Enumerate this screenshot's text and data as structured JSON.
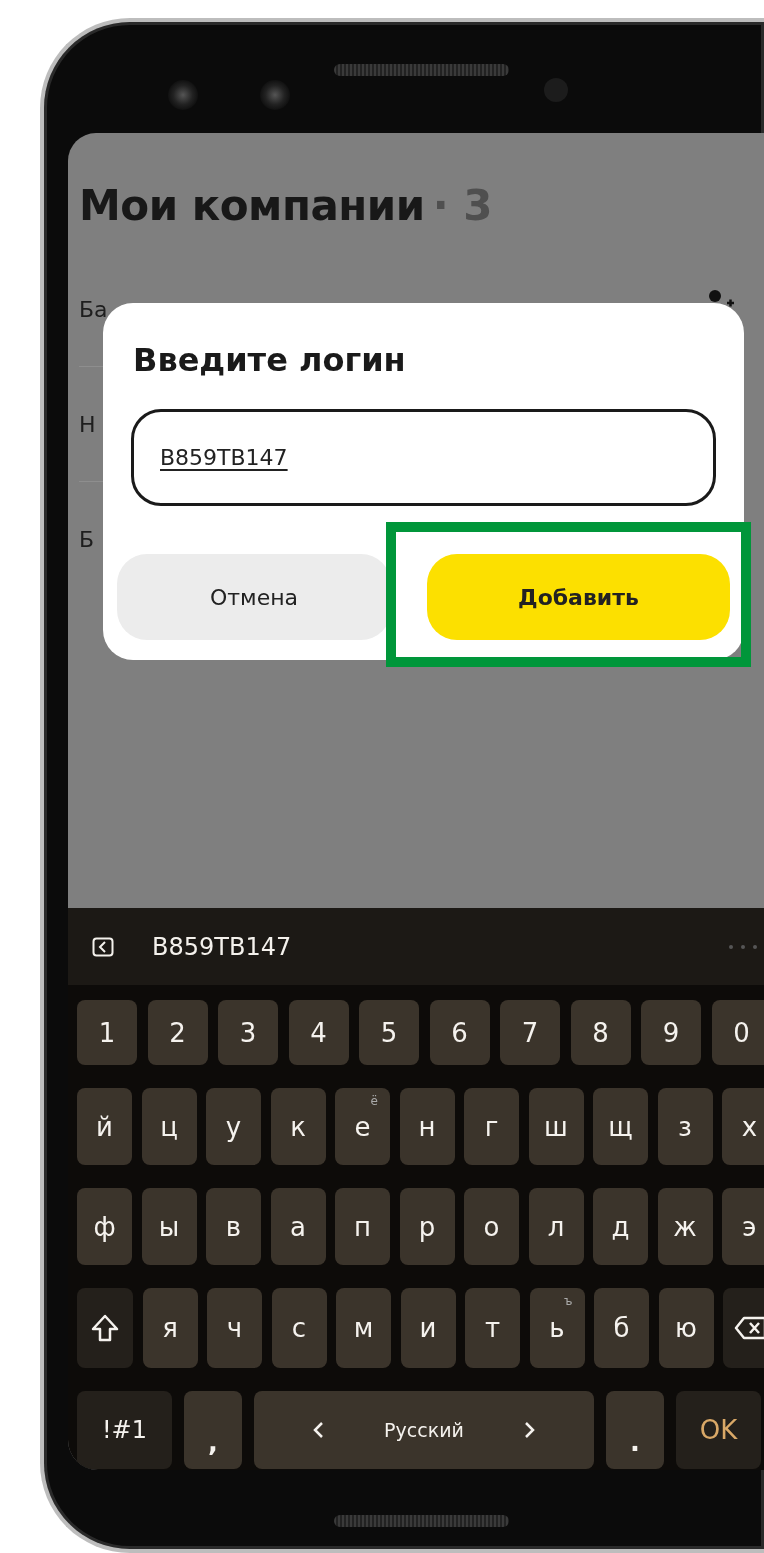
{
  "screen": {
    "title": "Мои компании",
    "count": "· 3",
    "list_items": [
      "Ба",
      "Н",
      "Б"
    ]
  },
  "dialog": {
    "title": "Введите логин",
    "input": {
      "value": "B859TB147"
    },
    "buttons": [
      {
        "label": "Отмена",
        "kind": "secondary",
        "highlighted": false
      },
      {
        "label": "Добавить",
        "kind": "primary",
        "highlighted": true
      }
    ]
  },
  "keyboard": {
    "suggestion": "B859TB147",
    "key_rows": [
      {
        "keys": [
          {
            "kind": "digit",
            "label": "1"
          },
          {
            "kind": "digit",
            "label": "2"
          },
          {
            "kind": "digit",
            "label": "3"
          },
          {
            "kind": "digit",
            "label": "4"
          },
          {
            "kind": "digit",
            "label": "5"
          },
          {
            "kind": "digit",
            "label": "6"
          },
          {
            "kind": "digit",
            "label": "7"
          },
          {
            "kind": "digit",
            "label": "8"
          },
          {
            "kind": "digit",
            "label": "9"
          },
          {
            "kind": "digit",
            "label": "0"
          }
        ]
      },
      {
        "keys": [
          {
            "kind": "char",
            "label": "й"
          },
          {
            "kind": "char",
            "label": "ц"
          },
          {
            "kind": "char",
            "label": "у"
          },
          {
            "kind": "char",
            "label": "к"
          },
          {
            "kind": "char",
            "label": "е",
            "hint": "ё"
          },
          {
            "kind": "char",
            "label": "н"
          },
          {
            "kind": "char",
            "label": "г"
          },
          {
            "kind": "char",
            "label": "ш"
          },
          {
            "kind": "char",
            "label": "щ"
          },
          {
            "kind": "char",
            "label": "з"
          },
          {
            "kind": "char",
            "label": "х"
          }
        ]
      },
      {
        "keys": [
          {
            "kind": "char",
            "label": "ф"
          },
          {
            "kind": "char",
            "label": "ы"
          },
          {
            "kind": "char",
            "label": "в"
          },
          {
            "kind": "char",
            "label": "а"
          },
          {
            "kind": "char",
            "label": "п"
          },
          {
            "kind": "char",
            "label": "р"
          },
          {
            "kind": "char",
            "label": "о"
          },
          {
            "kind": "char",
            "label": "л"
          },
          {
            "kind": "char",
            "label": "д"
          },
          {
            "kind": "char",
            "label": "ж"
          },
          {
            "kind": "char",
            "label": "э"
          }
        ]
      },
      {
        "keys": [
          {
            "kind": "shift"
          },
          {
            "kind": "char",
            "label": "я"
          },
          {
            "kind": "char",
            "label": "ч"
          },
          {
            "kind": "char",
            "label": "с"
          },
          {
            "kind": "char",
            "label": "м"
          },
          {
            "kind": "char",
            "label": "и"
          },
          {
            "kind": "char",
            "label": "т"
          },
          {
            "kind": "char",
            "label": "ь",
            "hint": "ъ"
          },
          {
            "kind": "char",
            "label": "б"
          },
          {
            "kind": "char",
            "label": "ю"
          },
          {
            "kind": "backspace"
          }
        ]
      },
      {
        "keys": [
          {
            "kind": "symbols",
            "label": "!#1"
          },
          {
            "kind": "punct",
            "label": ","
          },
          {
            "kind": "space",
            "label": "Русский"
          },
          {
            "kind": "punct",
            "label": "."
          },
          {
            "kind": "ok",
            "label": "OK"
          }
        ]
      }
    ]
  }
}
